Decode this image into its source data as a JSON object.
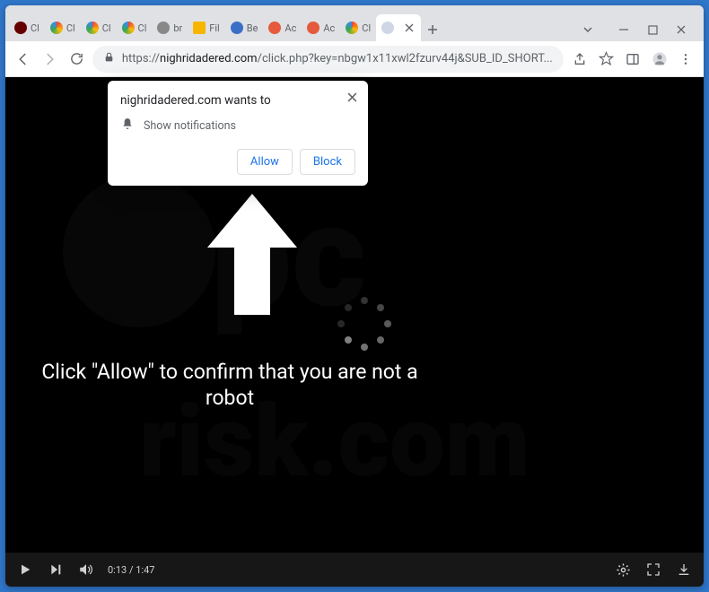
{
  "window": {
    "title_bar": {
      "min": "–",
      "max": "☐",
      "close": "✕",
      "caret": "⌄"
    }
  },
  "tabs": [
    {
      "label": "Cl",
      "favicon": "red-circle"
    },
    {
      "label": "Cl",
      "favicon": "chrome"
    },
    {
      "label": "Cl",
      "favicon": "chrome"
    },
    {
      "label": "Cl",
      "favicon": "chrome"
    },
    {
      "label": "br",
      "favicon": "globe"
    },
    {
      "label": "Fil",
      "favicon": "folder"
    },
    {
      "label": "Be",
      "favicon": "shield"
    },
    {
      "label": "Ac",
      "favicon": "nosign"
    },
    {
      "label": "Ac",
      "favicon": "nosign"
    },
    {
      "label": "Cl",
      "favicon": "chrome"
    },
    {
      "label": "",
      "favicon": "page",
      "active": true
    }
  ],
  "addressbar": {
    "protocol": "https://",
    "host": "nighridadered.com",
    "path": "/click.php?key=nbgw1x11xwl2fzurv44j&SUB_ID_SHORT..."
  },
  "notification": {
    "title": "nighridadered.com wants to",
    "subtitle": "Show notifications",
    "allow": "Allow",
    "block": "Block"
  },
  "page": {
    "prompt": "Click \"Allow\" to confirm that you are not a robot"
  },
  "video": {
    "current_time": "0:13",
    "total_time": "1:47"
  }
}
